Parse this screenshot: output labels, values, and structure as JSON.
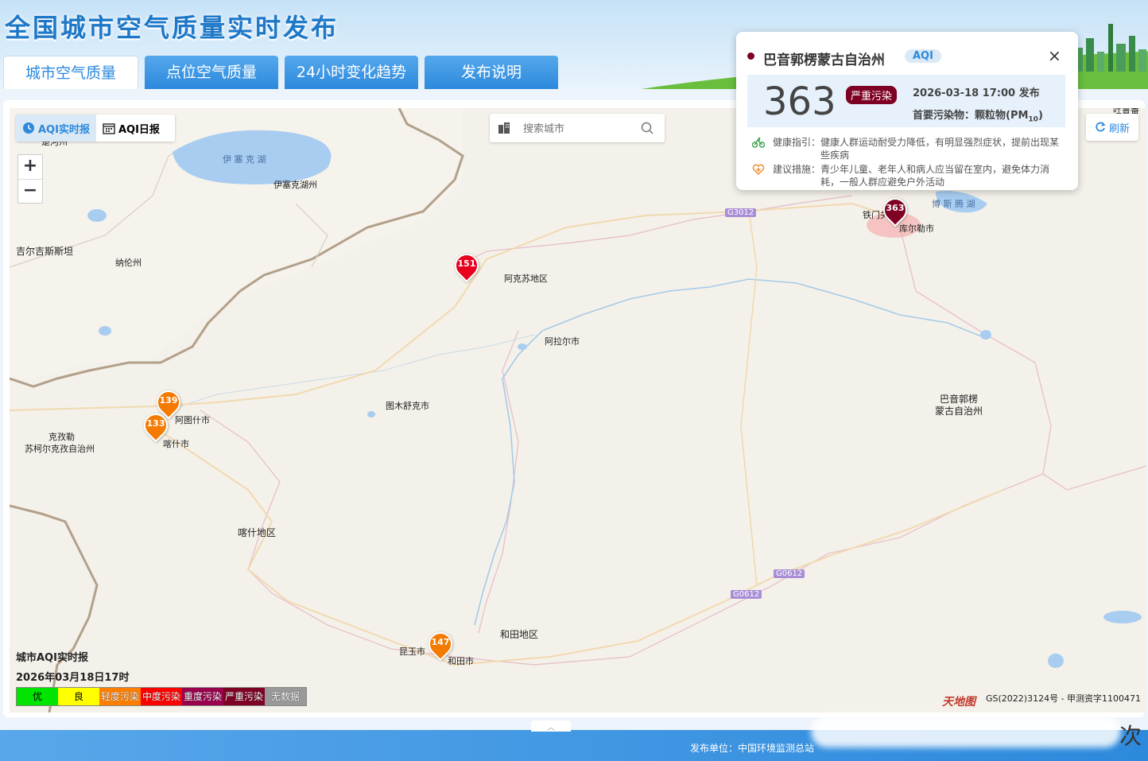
{
  "header": {
    "title": "全国城市空气质量实时发布",
    "tabs": [
      {
        "label": "城市空气质量",
        "active": true
      },
      {
        "label": "点位空气质量",
        "active": false
      },
      {
        "label": "24小时变化趋势",
        "active": false
      },
      {
        "label": "发布说明",
        "active": false
      }
    ]
  },
  "toolbar": {
    "mode_realtime": "AQI实时报",
    "mode_daily": "AQI日报",
    "zoom_in": "+",
    "zoom_out": "−",
    "search_placeholder": "搜索城市",
    "refresh_label": "刷新"
  },
  "map_labels": {
    "yining_lake": "伊 塞 克 湖",
    "yisaike_prefecture": "伊塞克湖州",
    "kyrgyzstan": "吉尔吉斯斯坦",
    "naryn": "纳伦州",
    "aksu": "阿克苏地区",
    "alar": "阿拉尔市",
    "tumxuk": "图木舒克市",
    "artux": "阿图什市",
    "kashgar_city": "喀什市",
    "kizilsu_1": "克孜勒",
    "kizilsu_2": "苏柯尔克孜自治州",
    "kashgar_region": "喀什地区",
    "hotan_region": "和田地区",
    "kunyu": "昆玉市",
    "hotan_city": "和田市",
    "tiemenguan": "铁门关",
    "korla": "库尔勒市",
    "bosten_lake": "博 斯 腾 湖",
    "bayingol_1": "巴音郭楞",
    "bayingol_2": "蒙古自治州",
    "road_g3012": "G3012",
    "road_g0612_a": "G0612",
    "road_g0612_b": "G0612",
    "top_left_cut": "楚河州",
    "top_right_cut": "吐鲁番"
  },
  "markers": [
    {
      "name": "aksu",
      "value": "151",
      "color": "#e8001c"
    },
    {
      "name": "artux",
      "value": "139",
      "color": "#f47a00"
    },
    {
      "name": "kashgar",
      "value": "133",
      "color": "#f47a00"
    },
    {
      "name": "hotan",
      "value": "147",
      "color": "#f47a00"
    },
    {
      "name": "korla",
      "value": "363",
      "color": "#7e0023"
    }
  ],
  "popup": {
    "city": "巴音郭楞蒙古自治州",
    "tag": "AQI",
    "aqi": "363",
    "level": "严重污染",
    "level_color": "#7e0023",
    "publish_time": "2026-03-18 17:00",
    "publish_suffix": "发布",
    "primary_pollutant_label": "首要污染物：颗粒物(PM",
    "primary_pollutant_sub": "10",
    "primary_pollutant_end": ")",
    "health_label": "健康指引：",
    "health_text": "健康人群运动耐受力降低，有明显强烈症状，提前出现某些疾病",
    "advice_label": "建议措施：",
    "advice_text": "青少年儿童、老年人和病人应当留在室内，避免体力消耗，一般人群应避免户外活动",
    "close": "×"
  },
  "legend": {
    "title": "城市AQI实时报",
    "date": "2026年03月18日17时",
    "levels": [
      {
        "label": "优",
        "color": "#00e400",
        "text_color": "#000"
      },
      {
        "label": "良",
        "color": "#ffff00",
        "text_color": "#000"
      },
      {
        "label": "轻度污染",
        "color": "#ff7e00",
        "text_color": "#fff"
      },
      {
        "label": "中度污染",
        "color": "#ff0000",
        "text_color": "#fff"
      },
      {
        "label": "重度污染",
        "color": "#99004c",
        "text_color": "#fff"
      },
      {
        "label": "严重污染",
        "color": "#7e0023",
        "text_color": "#fff"
      },
      {
        "label": "无数据",
        "color": "#999999",
        "text_color": "#fff"
      }
    ]
  },
  "map_footer": {
    "provider": "天地图",
    "copyright": "GS(2022)3124号 - 甲测资字1100471"
  },
  "footer": {
    "publisher": "发布单位：中国环境监测总站",
    "handle": "︿",
    "corner_char": "次"
  }
}
